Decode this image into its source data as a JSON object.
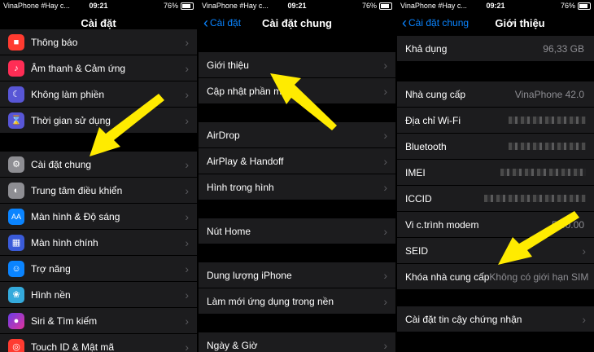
{
  "status_bars": [
    {
      "carrier": "VinaPhone #Hay c...",
      "time": "09:21",
      "battery": "76%"
    },
    {
      "carrier": "VinaPhone #Hay c...",
      "time": "09:21",
      "battery": "76%"
    },
    {
      "carrier": "VinaPhone #Hay c...",
      "time": "09:21",
      "battery": "76%"
    }
  ],
  "panel1": {
    "title": "Cài đặt",
    "items": [
      {
        "label": "Thông báo",
        "icon": "notification-icon",
        "color": "#ff3b30"
      },
      {
        "label": "Âm thanh & Cảm ứng",
        "icon": "sound-icon",
        "color": "#ff2d55"
      },
      {
        "label": "Không làm phiền",
        "icon": "moon-icon",
        "color": "#5856d6"
      },
      {
        "label": "Thời gian sử dụng",
        "icon": "hourglass-icon",
        "color": "#5856d6"
      },
      {
        "label": "Cài đặt chung",
        "icon": "gear-icon",
        "color": "#8e8e93"
      },
      {
        "label": "Trung tâm điều khiển",
        "icon": "toggle-icon",
        "color": "#8e8e93"
      },
      {
        "label": "Màn hình & Độ sáng",
        "icon": "brightness-icon",
        "color": "#0a84ff"
      },
      {
        "label": "Màn hình chính",
        "icon": "grid-icon",
        "color": "#3a5bd9"
      },
      {
        "label": "Trợ năng",
        "icon": "accessibility-icon",
        "color": "#0a84ff"
      },
      {
        "label": "Hình nền",
        "icon": "wallpaper-icon",
        "color": "#34aadc"
      },
      {
        "label": "Siri & Tìm kiếm",
        "icon": "siri-icon",
        "color": "#222"
      },
      {
        "label": "Touch ID & Mật mã",
        "icon": "fingerprint-icon",
        "color": "#ff3b30"
      }
    ]
  },
  "panel2": {
    "back": "Cài đặt",
    "title": "Cài đặt chung",
    "items": [
      "Giới thiệu",
      "Cập nhật phần mềm",
      "AirDrop",
      "AirPlay & Handoff",
      "Hình trong hình",
      "Nút Home",
      "Dung lượng iPhone",
      "Làm mới ứng dụng trong nền",
      "Ngày & Giờ"
    ]
  },
  "panel3": {
    "back": "Cài đặt chung",
    "title": "Giới thiệu",
    "items": [
      {
        "label": "Khả dụng",
        "value": "96,33 GB"
      },
      {
        "label": "Nhà cung cấp",
        "value": "VinaPhone 42.0"
      },
      {
        "label": "Địa chỉ Wi-Fi",
        "value": ""
      },
      {
        "label": "Bluetooth",
        "value": ""
      },
      {
        "label": "IMEI",
        "value": ""
      },
      {
        "label": "ICCID",
        "value": ""
      },
      {
        "label": "Vi c.trình modem",
        "value": "5.00.00"
      },
      {
        "label": "SEID",
        "value": ""
      },
      {
        "label": "Khóa nhà cung cấp",
        "value": "Không có giới hạn SIM"
      },
      {
        "label": "Cài đặt tin cậy chứng nhận",
        "value": ""
      }
    ]
  },
  "colors": {
    "accent": "#0a84ff",
    "annotation_arrow": "#ffeb00"
  }
}
